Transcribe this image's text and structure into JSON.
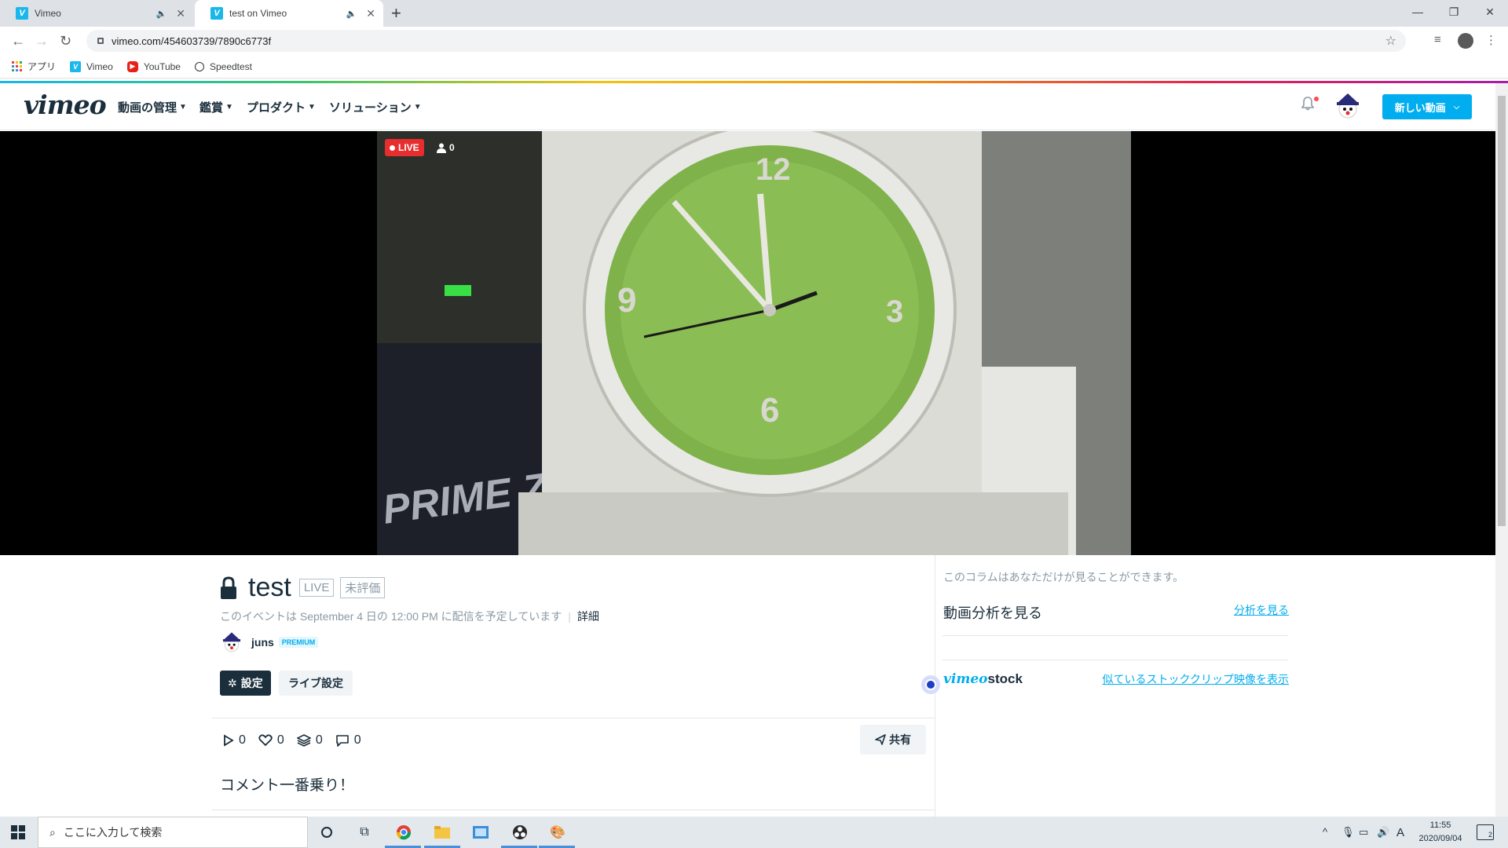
{
  "browser": {
    "tabs": [
      {
        "title": "Vimeo",
        "favicon": "V",
        "audio_icon": "🔈",
        "close": "✕"
      },
      {
        "title": "test on Vimeo",
        "favicon": "V",
        "audio_icon": "🔈",
        "close": "✕"
      }
    ],
    "new_tab": "+",
    "address": "vimeo.com/454603739/7890c6773f",
    "bookmarks": [
      {
        "label": "アプリ",
        "icon": "apps-grid-icon"
      },
      {
        "label": "Vimeo",
        "icon": "vimeo-icon"
      },
      {
        "label": "YouTube",
        "icon": "youtube-icon"
      },
      {
        "label": "Speedtest",
        "icon": "speedtest-icon"
      }
    ],
    "window_controls": {
      "minimize": "—",
      "restore": "❐",
      "close": "✕"
    }
  },
  "vimeo": {
    "logo": "vimeo",
    "nav": [
      {
        "label": "動画の管理"
      },
      {
        "label": "鑑賞"
      },
      {
        "label": "プロダクト"
      },
      {
        "label": "ソリューション"
      }
    ],
    "new_video_button": "新しい動画",
    "accent": "#00adef"
  },
  "player": {
    "live_label": "LIVE",
    "viewers": "0"
  },
  "video_info": {
    "title": "test",
    "tags": [
      "LIVE",
      "未評価"
    ],
    "schedule": "このイベントは September 4 日の 12:00 PM に配信を予定しています",
    "details_link": "詳細",
    "owner": "juns",
    "badge": "PREMIUM",
    "settings_button": "設定",
    "live_settings_button": "ライブ設定",
    "stats": {
      "plays": "0",
      "likes": "0",
      "collections": "0",
      "comments": "0"
    },
    "share_button": "共有",
    "comments_heading": "コメント一番乗り！"
  },
  "sidebar": {
    "private_note": "このコラムはあなただけが見ることができます。",
    "analytics_title": "動画分析を見る",
    "analytics_link": "分析を見る",
    "stock_logo_v": "vimeo",
    "stock_logo_s": "stock",
    "stock_link": "似ているストッククリップ映像を表示"
  },
  "taskbar": {
    "search_placeholder": "ここに入力して検索",
    "time": "11:55",
    "date": "2020/09/04",
    "ime": "A",
    "notifications": "2"
  }
}
